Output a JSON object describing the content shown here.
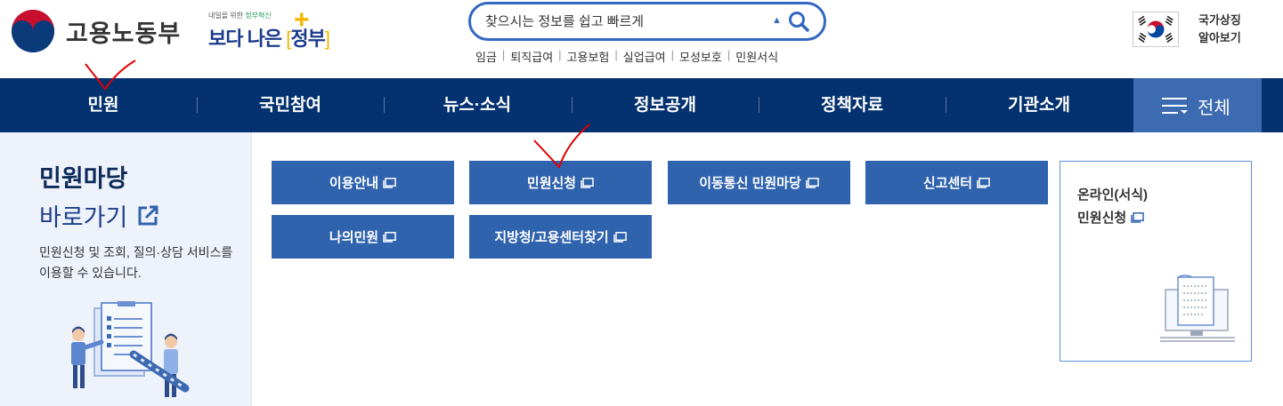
{
  "header": {
    "logo_text": "고용노동부",
    "slogan": {
      "small_pre": "내일을 위한 ",
      "small_green": "정부혁신",
      "main": "보다 나은",
      "main_jeongbu": "정부"
    },
    "search": {
      "placeholder": "찾으시는 정보를 쉽고 빠르게"
    },
    "quick_links": [
      "임금",
      "퇴직급여",
      "고용보험",
      "실업급여",
      "모성보호",
      "민원서식"
    ],
    "symbol": {
      "line1": "국가상징",
      "line2": "알아보기"
    }
  },
  "nav": {
    "items": [
      "민원",
      "국민참여",
      "뉴스·소식",
      "정보공개",
      "정책자료",
      "기관소개"
    ],
    "all_label": "전체"
  },
  "left_panel": {
    "title": "민원마당",
    "subtitle": "바로가기",
    "desc": "민원신청 및 조회, 질의·상담 서비스를 이용할 수 있습니다."
  },
  "buttons": {
    "row1": [
      "이용안내",
      "민원신청",
      "이동통신 민원마당",
      "신고센터"
    ],
    "row2": [
      "나의민원",
      "지방청/고용센터찾기"
    ]
  },
  "card": {
    "line1": "온라인(서식)",
    "line2": "민원신청"
  },
  "colors": {
    "nav_bg": "#04316f",
    "button_bg": "#2f63ae",
    "accent": "#3268c1",
    "panel_bg": "#eef2fb",
    "annotation": "#e00000"
  }
}
